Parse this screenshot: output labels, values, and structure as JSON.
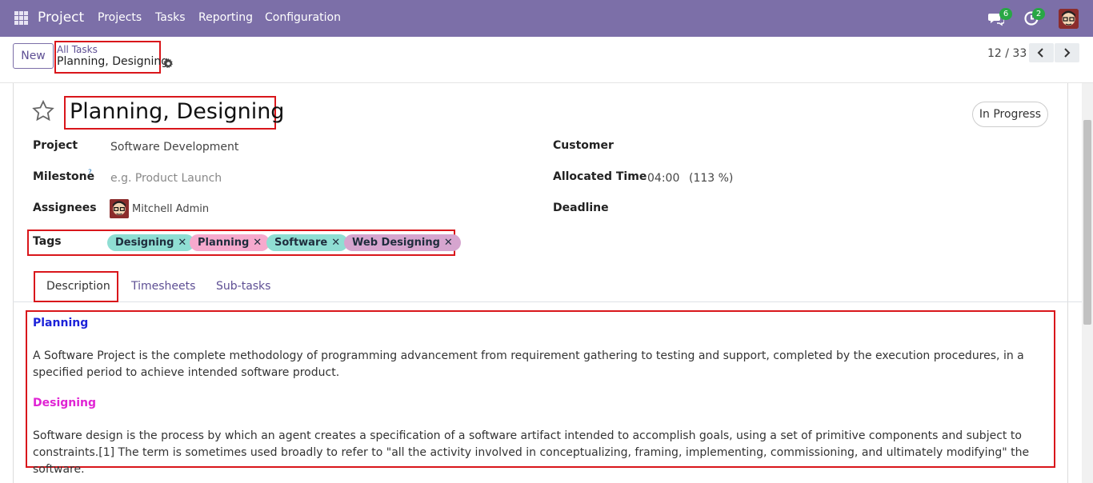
{
  "topbar": {
    "app_name": "Project",
    "nav": [
      "Projects",
      "Tasks",
      "Reporting",
      "Configuration"
    ],
    "messages_count": "6",
    "activities_count": "2",
    "bar_color": "#7c6fa8"
  },
  "control": {
    "new_label": "New",
    "breadcrumb_parent": "All Tasks",
    "breadcrumb_current": "Planning, Designing",
    "pager": "12 / 33"
  },
  "task": {
    "title": "Planning, Designing",
    "status": "In Progress",
    "fields": {
      "project_label": "Project",
      "project_value": "Software Development",
      "milestone_label": "Milestone",
      "milestone_help": "?",
      "milestone_placeholder": "e.g. Product Launch",
      "assignees_label": "Assignees",
      "assignees_value": "Mitchell Admin",
      "tags_label": "Tags",
      "customer_label": "Customer",
      "allocated_label": "Allocated Time",
      "allocated_value": "04:00",
      "allocated_percent": "(113 %)",
      "deadline_label": "Deadline"
    },
    "tags": [
      {
        "label": "Designing",
        "color": "#8fded3"
      },
      {
        "label": "Planning",
        "color": "#f6a9cd"
      },
      {
        "label": "Software",
        "color": "#8fded3"
      },
      {
        "label": "Web Designing",
        "color": "#d6a5cf"
      }
    ]
  },
  "tabs": [
    "Description",
    "Timesheets",
    "Sub-tasks"
  ],
  "description": {
    "heading1": "Planning",
    "para1": "A Software Project is the complete methodology of programming advancement from requirement gathering to testing and support, completed by the execution procedures, in a specified period to achieve intended software product.",
    "heading2": "Designing",
    "para2": "Software design is the process by which an agent creates a specification of a software artifact intended to accomplish goals, using a set of primitive components and subject to constraints.[1] The term is sometimes used broadly to refer to \"all the activity involved in conceptualizing, framing, implementing, commissioning, and ultimately modifying\" the software.",
    "heading1_color": "#1c22d9",
    "heading2_color": "#e023d4"
  }
}
